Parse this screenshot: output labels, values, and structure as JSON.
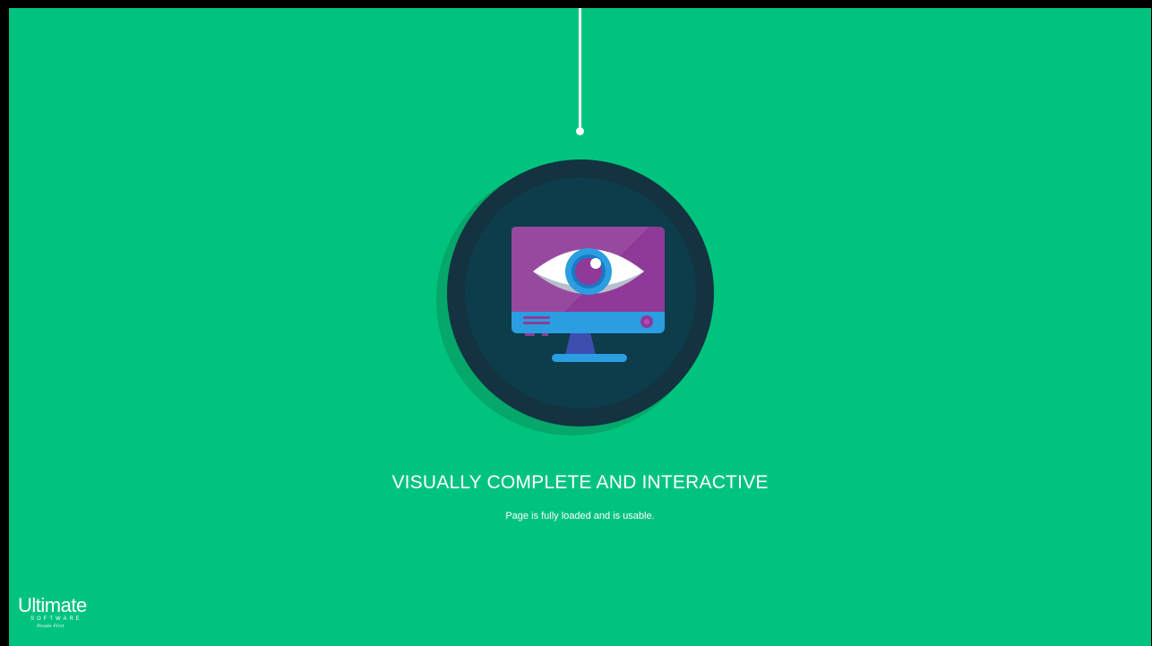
{
  "screen": {
    "title": "VISUALLY COMPLETE AND INTERACTIVE",
    "subtitle": "Page is fully loaded and is usable.",
    "illustration_icon": "monitor-eye-icon"
  },
  "brand": {
    "name": "Ultimate",
    "sub": "SOFTWARE",
    "tagline": "People First"
  },
  "colors": {
    "background": "#00c47e",
    "circle_outer": "#12333f",
    "circle_inner": "#0d3c4b",
    "screen": "#8f3a98",
    "bezel": "#2a9ee0",
    "stand": "#3c4fae",
    "text": "#ffffff"
  }
}
